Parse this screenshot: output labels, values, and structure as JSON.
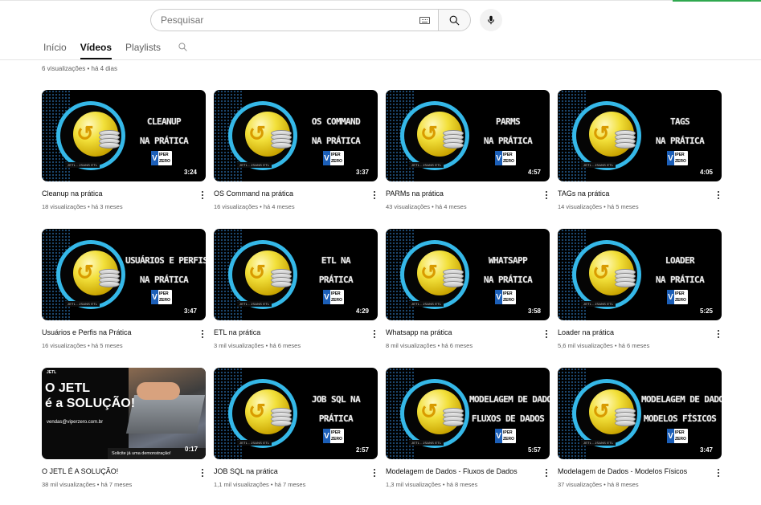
{
  "search": {
    "placeholder": "Pesquisar"
  },
  "tabs": [
    {
      "label": "Início",
      "active": false
    },
    {
      "label": "Vídeos",
      "active": true
    },
    {
      "label": "Playlists",
      "active": false
    }
  ],
  "previous_row_meta": "6 visualizações • há 4 dias",
  "colors": {
    "accent_ring": "#35b8e8",
    "thumb_bg": "#000000",
    "active_tab": "#0f0f0f"
  },
  "icons": [
    "keyboard-icon",
    "search-icon",
    "microphone-icon",
    "more-vert-icon"
  ],
  "thumb_brand": {
    "logo_v": "V",
    "logo_text_1": "IPER",
    "logo_text_2": "ZERO",
    "tag": "JETL - JSANS ETL"
  },
  "videos": [
    {
      "title": "Cleanup na prática",
      "meta": "18 visualizações • há 3 meses",
      "duration": "3:24",
      "thumb_line1": "CLEANUP",
      "thumb_line2": "NA PRÁTICA"
    },
    {
      "title": "OS Command na prática",
      "meta": "16 visualizações • há 4 meses",
      "duration": "3:37",
      "thumb_line1": "OS COMMAND",
      "thumb_line2": "NA PRÁTICA"
    },
    {
      "title": "PARMs na prática",
      "meta": "43 visualizações • há 4 meses",
      "duration": "4:57",
      "thumb_line1": "PARMS",
      "thumb_line2": "NA PRÁTICA"
    },
    {
      "title": "TAGs na prática",
      "meta": "14 visualizações • há 5 meses",
      "duration": "4:05",
      "thumb_line1": "TAGS",
      "thumb_line2": "NA PRÁTICA"
    },
    {
      "title": "Usuários e Perfis na Prática",
      "meta": "16 visualizações • há 5 meses",
      "duration": "3:47",
      "thumb_line1": "USUÁRIOS E PERFIS",
      "thumb_line2": "NA PRÁTICA"
    },
    {
      "title": "ETL na prática",
      "meta": "3 mil visualizações • há 6 meses",
      "duration": "4:29",
      "thumb_line1": "ETL NA",
      "thumb_line2": "PRÁTICA"
    },
    {
      "title": "Whatsapp na prática",
      "meta": "8 mil visualizações • há 6 meses",
      "duration": "3:58",
      "thumb_line1": "WHATSAPP",
      "thumb_line2": "NA PRÁTICA"
    },
    {
      "title": "Loader na prática",
      "meta": "5,6 mil visualizações • há 6 meses",
      "duration": "5:25",
      "thumb_line1": "LOADER",
      "thumb_line2": "NA PRÁTICA"
    },
    {
      "title": "O JETL É A SOLUÇÃO!",
      "meta": "38 mil visualizações • há 7 meses",
      "duration": "0:17",
      "promo": {
        "logo": "JETL",
        "headline_1": "O JETL",
        "headline_2": "é a SOLUÇÃO!",
        "email": "vendas@viperzero.com.br",
        "cta": "Solicite já uma demonstração!"
      }
    },
    {
      "title": "JOB SQL na prática",
      "meta": "1,1 mil visualizações • há 7 meses",
      "duration": "2:57",
      "thumb_line1": "JOB SQL NA",
      "thumb_line2": "PRÁTICA"
    },
    {
      "title": "Modelagem de Dados - Fluxos de Dados",
      "meta": "1,3 mil visualizações • há 8 meses",
      "duration": "5:57",
      "thumb_line1": "MODELAGEM DE DADOS",
      "thumb_line2": "FLUXOS DE DADOS"
    },
    {
      "title": "Modelagem de Dados - Modelos Físicos",
      "meta": "37 visualizações • há 8 meses",
      "duration": "3:47",
      "thumb_line1": "MODELAGEM DE DADOS",
      "thumb_line2": "MODELOS FÍSICOS"
    }
  ]
}
